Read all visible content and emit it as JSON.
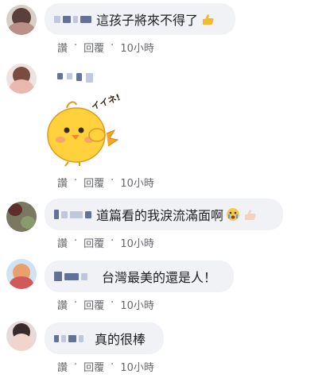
{
  "comments": [
    {
      "text": "這孩子將來不得了",
      "emoji": "thumbs-up-icon",
      "actions": {
        "like": "讚",
        "reply": "回覆",
        "time": "10小時"
      }
    },
    {
      "sticker": "chick-sticker",
      "sticker_text": "イイネ!",
      "actions": {
        "like": "讚",
        "reply": "回覆",
        "time": "10小時"
      }
    },
    {
      "text": "道篇看的我淚流滿面啊",
      "emoji": "crying-face-icon",
      "emoji2": "thumbs-up-icon",
      "actions": {
        "like": "讚",
        "reply": "回覆",
        "time": "10小時"
      }
    },
    {
      "text": "台灣最美的還是人！",
      "actions": {
        "like": "讚",
        "reply": "回覆",
        "time": "10小時"
      }
    },
    {
      "text": "真的很棒",
      "actions": {
        "like": "讚",
        "reply": "回覆",
        "time": "10小時"
      }
    }
  ],
  "separator": "·",
  "colors": {
    "bubble": "#f0f2f5",
    "meta": "#65676b",
    "text": "#1c1e21"
  }
}
